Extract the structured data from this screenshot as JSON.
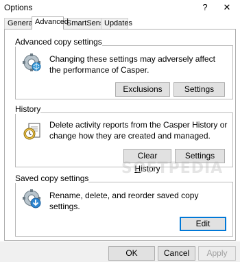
{
  "window": {
    "title": "Options",
    "help_label": "?",
    "close_label": "✕"
  },
  "tabs": [
    {
      "label": "General",
      "active": false
    },
    {
      "label": "Advanced",
      "active": true
    },
    {
      "label": "SmartSense",
      "active": false
    },
    {
      "label": "Updates",
      "active": false
    }
  ],
  "advanced_copy": {
    "heading": "Advanced copy settings",
    "description": "Changing these settings may adversely affect the performance of Casper.",
    "icon": "gear-globe-icon",
    "exclusions_label": "Exclusions",
    "settings_label": "Settings"
  },
  "history": {
    "heading": "History",
    "description": "Delete activity reports from the Casper History or change how they are created and managed.",
    "icon": "clock-document-icon",
    "clear_label_pre": "Clear ",
    "clear_label_ul": "H",
    "clear_label_post": "istory",
    "settings_label": "Settings"
  },
  "saved_copy": {
    "heading": "Saved copy settings",
    "description": "Rename, delete, and reorder saved copy settings.",
    "icon": "gear-download-icon",
    "edit_label": "Edit"
  },
  "footer": {
    "ok_label": "OK",
    "cancel_label": "Cancel",
    "apply_label": "Apply"
  },
  "watermark": "SOFTPEDIA",
  "colors": {
    "accent": "#0078d7",
    "button_bg": "#e1e1e1",
    "dialog_bg": "#f0f0f0"
  }
}
